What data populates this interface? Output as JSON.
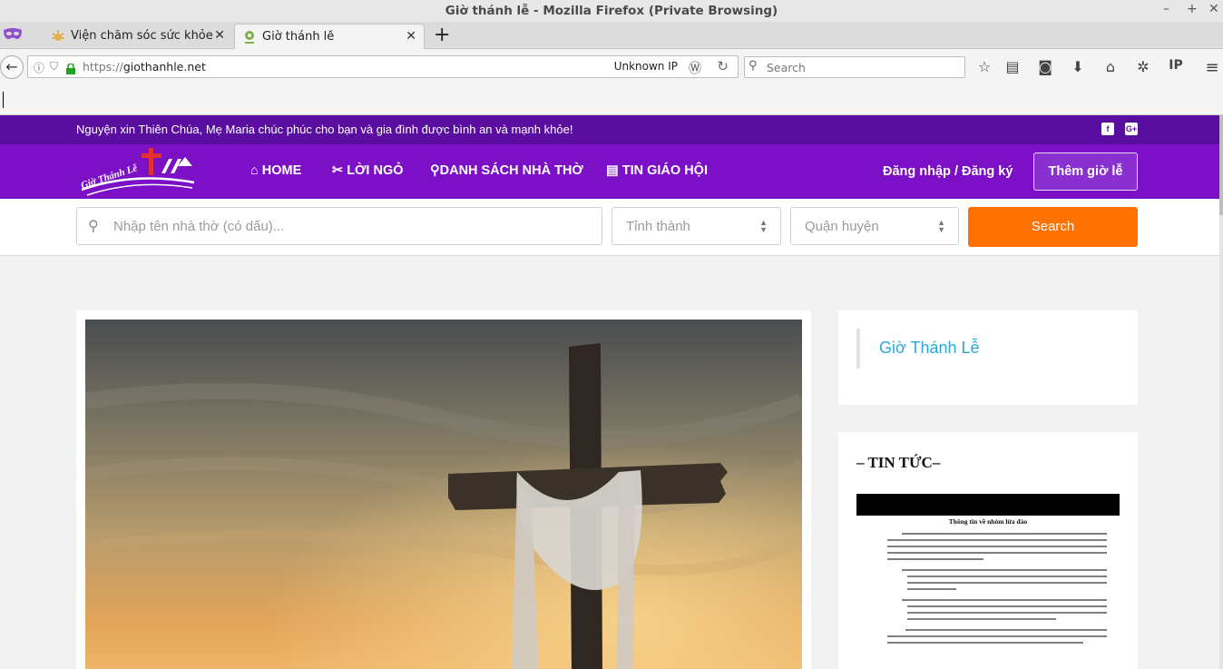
{
  "window": {
    "title": "Giờ thánh lễ - Mozilla Firefox (Private Browsing)"
  },
  "tabs": [
    {
      "label": "Viện chăm sóc sức khỏe và",
      "active": false
    },
    {
      "label": "Giờ thánh lễ",
      "active": true
    }
  ],
  "nav": {
    "url_proto": "https://",
    "url_host": "giothanhle.net",
    "ip_label": "Unknown IP",
    "search_placeholder": "Search"
  },
  "site": {
    "announcement": "Nguyện xin Thiên Chúa, Mẹ Maria chúc phúc cho bạn và gia đình được bình an và mạnh khỏe!",
    "logo_text": "Giờ Thánh Lễ",
    "menu": [
      "HOME",
      "LỜI NGỎ",
      "DANH SÁCH NHÀ THỜ",
      "TIN GIÁO HỘI"
    ],
    "login": "Đăng nhập / Đăng ký",
    "add_button": "Thêm giờ lễ",
    "search": {
      "church_placeholder": "Nhập tên nhà thờ (có dấu)...",
      "province": "Tỉnh thành",
      "district": "Quận huyện",
      "button": "Search"
    },
    "sidebar": {
      "link": "Giờ Thánh Lễ",
      "news_heading": "– TIN TỨC–",
      "doc_title": "Thông tin về nhóm lừa đảo"
    }
  },
  "colors": {
    "purple_top": "#5a0e9f",
    "purple_nav": "#7b10c6",
    "orange": "#ff7100",
    "link_blue": "#29a8d8"
  }
}
